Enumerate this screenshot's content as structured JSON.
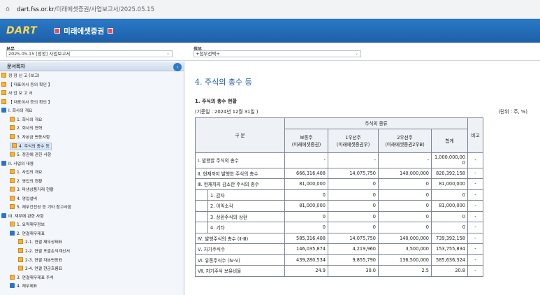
{
  "browser": {
    "url_host": "dart.fss.or.kr",
    "url_path": "/미래에셋증권/사업보고서/2025.05.15"
  },
  "header": {
    "logo": "DART",
    "company": "미래에셋증권"
  },
  "selectors": {
    "report_label": "본문",
    "report_value": "2025.05.15 [정정] 사업보고서",
    "attach_label": "첨부",
    "attach_value": "+첨부선택+"
  },
  "toc": {
    "title": "문서목차",
    "items": [
      {
        "label": "정 정 신 고 (보고)",
        "icon": "doc-icon",
        "level": 0
      },
      {
        "label": "【 대표이사 등의 확인 】",
        "icon": "doc-icon",
        "level": 0
      },
      {
        "label": "사 업 보 고 서",
        "icon": "doc-icon",
        "level": 0
      },
      {
        "label": "【 대표이사 등의 확인 】",
        "icon": "doc-icon",
        "level": 0
      },
      {
        "label": "I. 회사의 개요",
        "icon": "folder-icon",
        "level": 0
      },
      {
        "label": "1. 회사의 개요",
        "icon": "doc-icon",
        "level": 1
      },
      {
        "label": "2. 회사의 연혁",
        "icon": "doc-icon",
        "level": 1
      },
      {
        "label": "3. 자본금 변동사항",
        "icon": "doc-icon",
        "level": 1
      },
      {
        "label": "4. 주식의 총수 등",
        "icon": "doc-icon",
        "level": 1,
        "selected": true
      },
      {
        "label": "5. 정관에 관한 사항",
        "icon": "doc-icon",
        "level": 1
      },
      {
        "label": "II. 사업의 내용",
        "icon": "folder-icon",
        "level": 0
      },
      {
        "label": "1. 사업의 개요",
        "icon": "doc-icon",
        "level": 1
      },
      {
        "label": "2. 영업의 현황",
        "icon": "doc-icon",
        "level": 1
      },
      {
        "label": "3. 파생상품거래 현황",
        "icon": "doc-icon",
        "level": 1
      },
      {
        "label": "4. 영업설비",
        "icon": "doc-icon",
        "level": 1
      },
      {
        "label": "5. 재무건전성 등 기타 참고사항",
        "icon": "doc-icon",
        "level": 1
      },
      {
        "label": "III. 재무에 관한 사항",
        "icon": "folder-icon",
        "level": 0
      },
      {
        "label": "1. 요약재무정보",
        "icon": "doc-icon",
        "level": 1
      },
      {
        "label": "2. 연결재무제표",
        "icon": "folder-icon",
        "level": 1
      },
      {
        "label": "2-1. 연결 재무상태표",
        "icon": "doc-icon",
        "level": 2
      },
      {
        "label": "2-2. 연결 포괄손익계산서",
        "icon": "doc-icon",
        "level": 2
      },
      {
        "label": "2-3. 연결 자본변동표",
        "icon": "doc-icon",
        "level": 2
      },
      {
        "label": "2-4. 연결 현금흐름표",
        "icon": "doc-icon",
        "level": 2
      },
      {
        "label": "3. 연결재무제표 주석",
        "icon": "doc-icon",
        "level": 1
      },
      {
        "label": "4. 재무제표",
        "icon": "folder-icon",
        "level": 1
      }
    ]
  },
  "content": {
    "title": "4. 주식의 총수 등",
    "section": "1. 주식의 총수 현황",
    "basis": "(기준일 :      2024년 12월 31일    )",
    "unit": "(단위 : 주, %)",
    "table": {
      "h_gubun": "구 분",
      "h_kind": "주식의 종류",
      "h_common": "보통주",
      "h_common_sub": "(미래에셋증권)",
      "h_pref1": "1우선주",
      "h_pref1_sub": "(미래에셋증권우)",
      "h_pref2": "2우선주",
      "h_pref2_sub": "(미래에셋증권2우B)",
      "h_total": "합계",
      "h_note": "비고",
      "rows": [
        {
          "label": "Ⅰ. 발행할 주식의 총수",
          "v": [
            "-",
            "-",
            "-",
            "1,000,000,00",
            "-"
          ],
          "v4b": "0"
        },
        {
          "label": "Ⅱ. 현재까지 발행한 주식의 총수",
          "v": [
            "666,316,408",
            "14,075,750",
            "140,000,000",
            "820,392,158",
            "-"
          ]
        },
        {
          "label": "Ⅲ. 현재까지 감소한 주식의 총수",
          "v": [
            "81,000,000",
            "0",
            "0",
            "81,000,000",
            "-"
          ]
        },
        {
          "label": "1. 감자",
          "v": [
            "0",
            "0",
            "0",
            "0",
            "-"
          ],
          "sub": true
        },
        {
          "label": "2. 이익소각",
          "v": [
            "81,000,000",
            "0",
            "0",
            "81,000,000",
            "-"
          ],
          "sub": true
        },
        {
          "label": "3. 상환주식의 상환",
          "v": [
            "0",
            "0",
            "0",
            "0",
            "-"
          ],
          "sub": true
        },
        {
          "label": "4. 기타",
          "v": [
            "0",
            "0",
            "0",
            "0",
            "-"
          ],
          "sub": true
        },
        {
          "label": "Ⅳ. 발행주식의 총수 (Ⅱ-Ⅲ)",
          "v": [
            "585,316,408",
            "14,075,750",
            "140,000,000",
            "739,392,158",
            "-"
          ]
        },
        {
          "label": "Ⅴ. 자기주식수",
          "v": [
            "146,035,874",
            "4,219,960",
            "3,500,000",
            "153,755,834",
            "-"
          ]
        },
        {
          "label": "Ⅵ. 유통주식수 (Ⅳ-Ⅴ)",
          "v": [
            "439,280,534",
            "9,855,790",
            "136,500,000",
            "585,636,324",
            "-"
          ]
        },
        {
          "label": "Ⅶ. 자기주식 보유비율",
          "v": [
            "24.9",
            "30.0",
            "2.5",
            "20.8",
            "-"
          ]
        }
      ]
    }
  }
}
